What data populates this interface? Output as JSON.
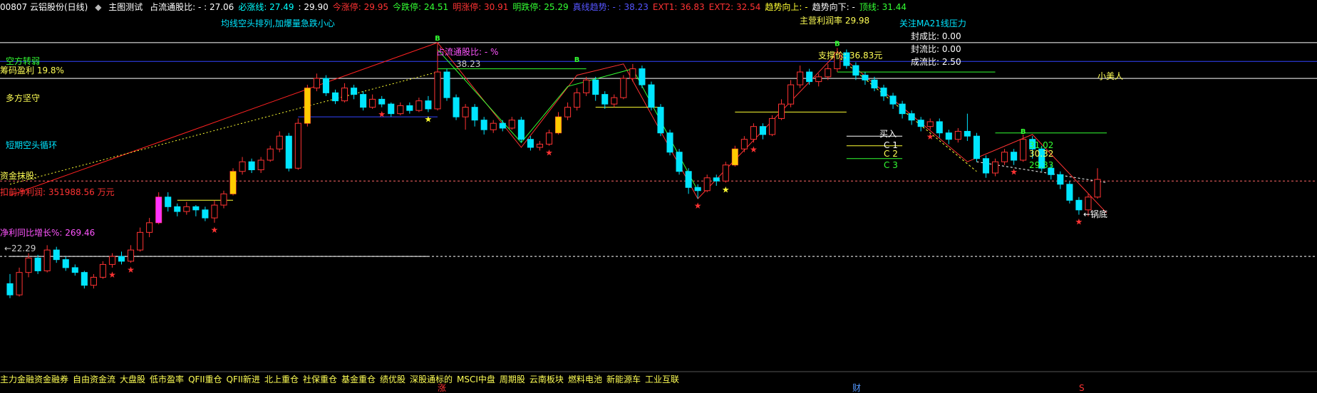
{
  "header": {
    "code_name": "00807 云铝股份(日线)",
    "title_sep": "◆",
    "indicator_name": "主图测试",
    "items": [
      {
        "label": "占流通股比: - : 27.06",
        "color": "#ffffff"
      },
      {
        "label": "必涨线: 27.49",
        "color": "#00ffff"
      },
      {
        "label": ": 29.90",
        "color": "#ffffff"
      },
      {
        "label": "今涨停: 29.95",
        "color": "#ff3333"
      },
      {
        "label": "今跌停: 24.51",
        "color": "#33ff33"
      },
      {
        "label": "明涨停: 30.91",
        "color": "#ff3333"
      },
      {
        "label": "明跌停: 25.29",
        "color": "#33ff33"
      },
      {
        "label": "真线趋势: - : 38.23",
        "color": "#5555ff"
      },
      {
        "label": "EXT1: 36.83",
        "color": "#ff3333"
      },
      {
        "label": "EXT2: 32.54",
        "color": "#ff3333"
      },
      {
        "label": "趋势向上: -",
        "color": "#ffff33"
      },
      {
        "label": "趋势向下: -",
        "color": "#ffffff"
      },
      {
        "label": "顶线: 31.44",
        "color": "#33ff33"
      }
    ]
  },
  "annotations": [
    {
      "name": "bear-alignment-warning",
      "text": "均线空头排列,加爆量急跌小心",
      "color": "#00e5ff"
    },
    {
      "name": "share-ratio-label",
      "text": "占流通股比: - %",
      "color": "#ff55ff"
    },
    {
      "name": "main-profit-rate",
      "text": "主营利润率 29.98",
      "color": "#ffff55"
    },
    {
      "name": "ma21-watch",
      "text": "关注MA21线压力",
      "color": "#00e5ff"
    },
    {
      "name": "seal-turnover",
      "text": "封成比: 0.00",
      "color": "#ffffff"
    },
    {
      "name": "seal-float",
      "text": "封流比: 0.00",
      "color": "#ffffff"
    },
    {
      "name": "turnover-float",
      "text": "成流比: 2.50",
      "color": "#ffffff"
    },
    {
      "name": "support-price",
      "text": "支撑价: 36.83元",
      "color": "#ffff55"
    },
    {
      "name": "bull-to-bear",
      "text": "空方转弱",
      "color": "#33ff33"
    },
    {
      "name": "chip-profit",
      "text": "筹码盈利 19.8%",
      "color": "#ffff55"
    },
    {
      "name": "bull-hold",
      "text": "多方坚守",
      "color": "#ffff55"
    },
    {
      "name": "short-bear-cycle",
      "text": "短期空头循环",
      "color": "#00e5ff"
    },
    {
      "name": "gold-lift",
      "text": "资金抹股:",
      "color": "#ffff55"
    },
    {
      "name": "net-profit",
      "text": "扣前净利润: 351988.56 万元",
      "color": "#ff3333"
    },
    {
      "name": "profit-growth",
      "text": "净利同比增长%: 269.46",
      "color": "#ff55ff"
    },
    {
      "name": "low-price",
      "text": "←22.29",
      "color": "#cccccc"
    },
    {
      "name": "high-price",
      "text": "38.23",
      "color": "#cccccc"
    },
    {
      "name": "small-beauty",
      "text": "小美人",
      "color": "#ffff55"
    },
    {
      "name": "buy-in",
      "text": "买入",
      "color": "#ffffff"
    },
    {
      "name": "c1",
      "text": "C 1",
      "color": "#ffffff"
    },
    {
      "name": "c2",
      "text": "C 2",
      "color": "#ffff55"
    },
    {
      "name": "c3",
      "text": "C 3",
      "color": "#33ff33"
    },
    {
      "name": "level-3102",
      "text": "31.02",
      "color": "#33ff33"
    },
    {
      "name": "level-3032",
      "text": "30.32",
      "color": "#ffff55"
    },
    {
      "name": "level-2933",
      "text": "29.33",
      "color": "#33ff33"
    },
    {
      "name": "pot-bottom",
      "text": "←锅底",
      "color": "#ffffff"
    }
  ],
  "bottom_bar": {
    "items": [
      "主力金融资金融券",
      "自由资金流",
      "大盘股",
      "低市盈率",
      "QFII重仓",
      "QFII新进",
      "北上重仓",
      "社保重仓",
      "基金重仓",
      "绩优股",
      "深股通标的",
      "MSCI中盘",
      "周期股",
      "云南板块",
      "燃料电池",
      "新能源车",
      "工业互联"
    ],
    "markers": [
      {
        "text": "涨",
        "color": "#ff3333"
      },
      {
        "text": "财",
        "color": "#5599ff"
      },
      {
        "text": "S",
        "color": "#ff3333"
      }
    ]
  },
  "colors": {
    "up": "#ff3333",
    "down": "#00e5ff",
    "bg": "#000000"
  },
  "chart_data": {
    "type": "candlestick",
    "ylim": [
      21.0,
      40.0
    ],
    "horizontal_levels": [
      {
        "name": "ext1",
        "value": 38.23,
        "color": "#ffffff"
      },
      {
        "name": "blue-line",
        "value": 37.06,
        "color": "#3344ff"
      },
      {
        "name": "ma21-line",
        "value": 36.0,
        "color": "#ffffff"
      },
      {
        "name": "gold-line",
        "value": 29.6,
        "color": "#ff6666",
        "dashed": true
      },
      {
        "name": "white-dash",
        "value": 24.9,
        "color": "#ffffff",
        "dashed": true
      }
    ],
    "candles": [
      [
        23.2,
        22.5,
        23.8,
        22.3
      ],
      [
        22.5,
        23.9,
        24.2,
        22.4
      ],
      [
        23.9,
        24.8,
        25.1,
        23.6
      ],
      [
        24.8,
        24.0,
        25.0,
        23.8
      ],
      [
        24.0,
        25.3,
        25.6,
        23.9
      ],
      [
        25.3,
        24.7,
        25.5,
        24.5
      ],
      [
        24.7,
        24.2,
        24.9,
        24.0
      ],
      [
        24.2,
        23.9,
        24.4,
        23.7
      ],
      [
        23.9,
        23.1,
        24.0,
        22.9
      ],
      [
        23.1,
        23.6,
        23.8,
        22.9
      ],
      [
        23.6,
        24.4,
        24.6,
        23.5
      ],
      [
        24.4,
        24.9,
        25.1,
        24.2
      ],
      [
        24.9,
        24.6,
        25.2,
        24.4
      ],
      [
        24.6,
        25.3,
        25.6,
        24.5
      ],
      [
        25.3,
        26.4,
        26.7,
        25.2
      ],
      [
        26.4,
        27.0,
        27.3,
        26.1
      ],
      [
        27.0,
        28.6,
        28.9,
        26.9
      ],
      [
        28.6,
        28.0,
        28.9,
        27.7
      ],
      [
        28.0,
        27.7,
        28.2,
        27.4
      ],
      [
        27.7,
        28.0,
        28.3,
        27.5
      ],
      [
        28.0,
        27.8,
        28.1,
        27.4
      ],
      [
        27.8,
        27.3,
        28.0,
        27.1
      ],
      [
        27.3,
        28.1,
        28.4,
        27.0
      ],
      [
        28.1,
        28.8,
        29.0,
        27.9
      ],
      [
        28.8,
        30.2,
        30.4,
        28.7
      ],
      [
        30.2,
        30.8,
        31.1,
        30.0
      ],
      [
        30.8,
        30.3,
        31.0,
        30.1
      ],
      [
        30.3,
        30.9,
        31.1,
        30.1
      ],
      [
        30.9,
        31.6,
        31.8,
        30.8
      ],
      [
        31.6,
        32.4,
        32.7,
        31.4
      ],
      [
        32.4,
        30.4,
        32.6,
        30.2
      ],
      [
        30.4,
        33.2,
        33.5,
        30.3
      ],
      [
        33.2,
        35.4,
        35.6,
        33.0
      ],
      [
        35.4,
        36.0,
        36.3,
        35.2
      ],
      [
        36.0,
        35.1,
        36.2,
        34.9
      ],
      [
        35.1,
        34.6,
        35.3,
        34.4
      ],
      [
        34.6,
        35.4,
        35.7,
        34.5
      ],
      [
        35.4,
        35.0,
        35.6,
        34.7
      ],
      [
        35.0,
        34.2,
        35.2,
        34.0
      ],
      [
        34.2,
        34.7,
        35.0,
        34.1
      ],
      [
        34.7,
        34.4,
        34.9,
        34.2
      ],
      [
        34.4,
        33.8,
        34.5,
        33.6
      ],
      [
        33.8,
        34.3,
        34.5,
        33.7
      ],
      [
        34.3,
        34.0,
        34.5,
        33.8
      ],
      [
        34.0,
        34.6,
        34.8,
        33.9
      ],
      [
        34.6,
        34.1,
        34.9,
        33.9
      ],
      [
        34.1,
        36.4,
        38.23,
        34.0
      ],
      [
        36.4,
        34.8,
        36.6,
        34.6
      ],
      [
        34.8,
        33.6,
        35.0,
        33.4
      ],
      [
        33.6,
        34.2,
        34.4,
        32.8
      ],
      [
        34.2,
        33.4,
        34.4,
        33.0
      ],
      [
        33.4,
        32.8,
        33.6,
        32.5
      ],
      [
        32.8,
        33.2,
        33.4,
        32.6
      ],
      [
        33.2,
        32.9,
        33.4,
        32.7
      ],
      [
        32.9,
        33.4,
        33.6,
        32.8
      ],
      [
        33.4,
        32.2,
        33.6,
        32.0
      ],
      [
        32.2,
        31.7,
        32.4,
        31.5
      ],
      [
        31.7,
        31.9,
        32.1,
        31.5
      ],
      [
        31.9,
        32.6,
        32.8,
        31.8
      ],
      [
        32.6,
        33.6,
        33.9,
        32.5
      ],
      [
        33.6,
        34.2,
        34.5,
        33.4
      ],
      [
        34.2,
        35.1,
        35.4,
        34.0
      ],
      [
        35.1,
        35.9,
        36.1,
        34.9
      ],
      [
        35.9,
        35.0,
        36.1,
        34.6
      ],
      [
        35.0,
        34.4,
        35.2,
        34.1
      ],
      [
        34.4,
        34.8,
        35.0,
        34.2
      ],
      [
        34.8,
        36.0,
        36.2,
        34.7
      ],
      [
        36.0,
        36.6,
        36.9,
        35.8
      ],
      [
        36.6,
        35.6,
        36.8,
        35.4
      ],
      [
        35.6,
        34.2,
        35.8,
        34.0
      ],
      [
        34.2,
        32.6,
        34.4,
        32.4
      ],
      [
        32.6,
        31.4,
        32.8,
        31.2
      ],
      [
        31.4,
        30.2,
        31.6,
        30.0
      ],
      [
        30.2,
        29.2,
        30.4,
        28.8
      ],
      [
        29.2,
        29.0,
        29.4,
        28.5
      ],
      [
        29.0,
        29.8,
        30.0,
        28.9
      ],
      [
        29.8,
        29.6,
        30.0,
        29.3
      ],
      [
        29.6,
        30.6,
        30.8,
        29.5
      ],
      [
        30.6,
        31.6,
        31.8,
        30.5
      ],
      [
        31.6,
        32.2,
        32.4,
        31.4
      ],
      [
        32.2,
        33.0,
        33.2,
        32.0
      ],
      [
        33.0,
        32.5,
        33.2,
        32.2
      ],
      [
        32.5,
        33.5,
        33.7,
        32.4
      ],
      [
        33.5,
        34.4,
        34.7,
        33.4
      ],
      [
        34.4,
        35.6,
        35.9,
        34.2
      ],
      [
        35.6,
        36.4,
        36.8,
        35.4
      ],
      [
        36.4,
        35.8,
        36.6,
        35.6
      ],
      [
        35.8,
        36.1,
        36.3,
        35.5
      ],
      [
        36.1,
        36.6,
        36.9,
        35.9
      ],
      [
        36.6,
        37.6,
        37.9,
        36.4
      ],
      [
        37.6,
        36.8,
        37.8,
        36.6
      ],
      [
        36.8,
        36.2,
        37.0,
        35.9
      ],
      [
        36.2,
        35.9,
        36.4,
        35.6
      ],
      [
        35.9,
        35.4,
        36.1,
        35.2
      ],
      [
        35.4,
        34.9,
        35.6,
        34.6
      ],
      [
        34.9,
        34.4,
        35.1,
        34.1
      ],
      [
        34.4,
        33.8,
        34.6,
        33.5
      ],
      [
        33.8,
        33.4,
        34.0,
        33.1
      ],
      [
        33.4,
        33.0,
        33.6,
        32.7
      ],
      [
        33.0,
        33.3,
        33.5,
        32.8
      ],
      [
        33.3,
        32.6,
        33.5,
        32.3
      ],
      [
        32.6,
        32.2,
        32.8,
        31.9
      ],
      [
        32.2,
        32.7,
        32.9,
        32.0
      ],
      [
        32.7,
        32.4,
        33.8,
        32.1
      ],
      [
        32.4,
        31.0,
        32.6,
        30.8
      ],
      [
        31.0,
        30.1,
        31.2,
        29.8
      ],
      [
        30.1,
        30.8,
        31.0,
        29.9
      ],
      [
        30.8,
        31.4,
        31.6,
        30.6
      ],
      [
        31.4,
        30.9,
        31.6,
        30.6
      ],
      [
        30.9,
        32.2,
        32.5,
        30.8
      ],
      [
        32.2,
        31.6,
        32.4,
        31.0
      ],
      [
        31.6,
        30.4,
        31.8,
        30.2
      ],
      [
        30.4,
        30.0,
        30.6,
        29.7
      ],
      [
        30.0,
        29.4,
        30.2,
        29.1
      ],
      [
        29.4,
        28.4,
        29.6,
        28.2
      ],
      [
        28.4,
        27.8,
        28.6,
        27.5
      ],
      [
        27.8,
        28.6,
        28.8,
        27.4
      ],
      [
        28.6,
        29.7,
        30.4,
        28.5
      ]
    ]
  }
}
